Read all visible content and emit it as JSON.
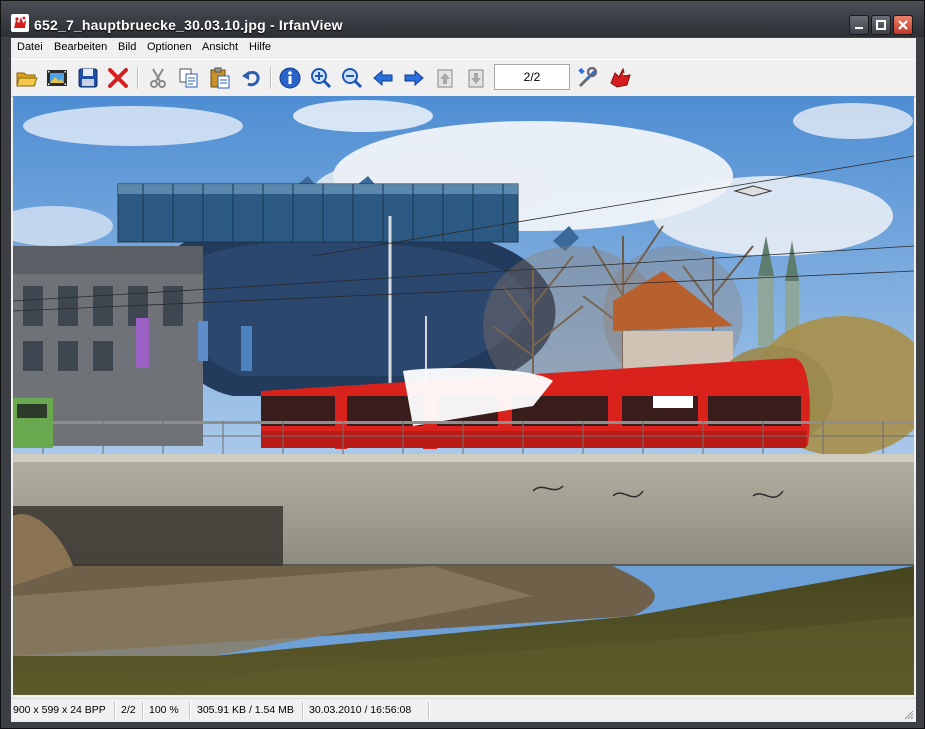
{
  "window": {
    "title": "652_7_hauptbruecke_30.03.10.jpg - IrfanView",
    "app_icon": "irfanview-red-cat-icon",
    "caption_buttons": [
      "minimize-icon",
      "maximize-icon",
      "close-icon"
    ]
  },
  "menu": {
    "items": [
      {
        "label": "Datei"
      },
      {
        "label": "Bearbeiten"
      },
      {
        "label": "Bild"
      },
      {
        "label": "Optionen"
      },
      {
        "label": "Ansicht"
      },
      {
        "label": "Hilfe"
      }
    ]
  },
  "toolbar": {
    "buttons": [
      {
        "icon": "open-folder-icon"
      },
      {
        "icon": "slideshow-icon"
      },
      {
        "icon": "save-icon"
      },
      {
        "icon": "delete-icon"
      },
      {
        "icon": "cut-icon"
      },
      {
        "icon": "copy-icon"
      },
      {
        "icon": "paste-icon"
      },
      {
        "icon": "undo-icon"
      },
      {
        "icon": "info-icon"
      },
      {
        "icon": "zoom-in-icon"
      },
      {
        "icon": "zoom-out-icon"
      },
      {
        "icon": "previous-icon"
      },
      {
        "icon": "next-icon"
      },
      {
        "icon": "first-file-icon"
      },
      {
        "icon": "last-file-icon"
      },
      {
        "icon": "settings-icon"
      },
      {
        "icon": "about-icon"
      }
    ],
    "page_field_value": "2/2"
  },
  "image": {
    "description_icon": "photo-image"
  },
  "statusbar": {
    "dimensions": "900 x 599 x 24 BPP",
    "page": "2/2",
    "zoom": "100 %",
    "size": "305.91 KB / 1.54 MB",
    "datetime": "30.03.2010 / 16:56:08"
  },
  "colors": {
    "accent_red": "#e2201d",
    "tram_red": "#d9221c",
    "sky_blue": "#6da0d6",
    "icon_blue": "#2d6fd6"
  }
}
